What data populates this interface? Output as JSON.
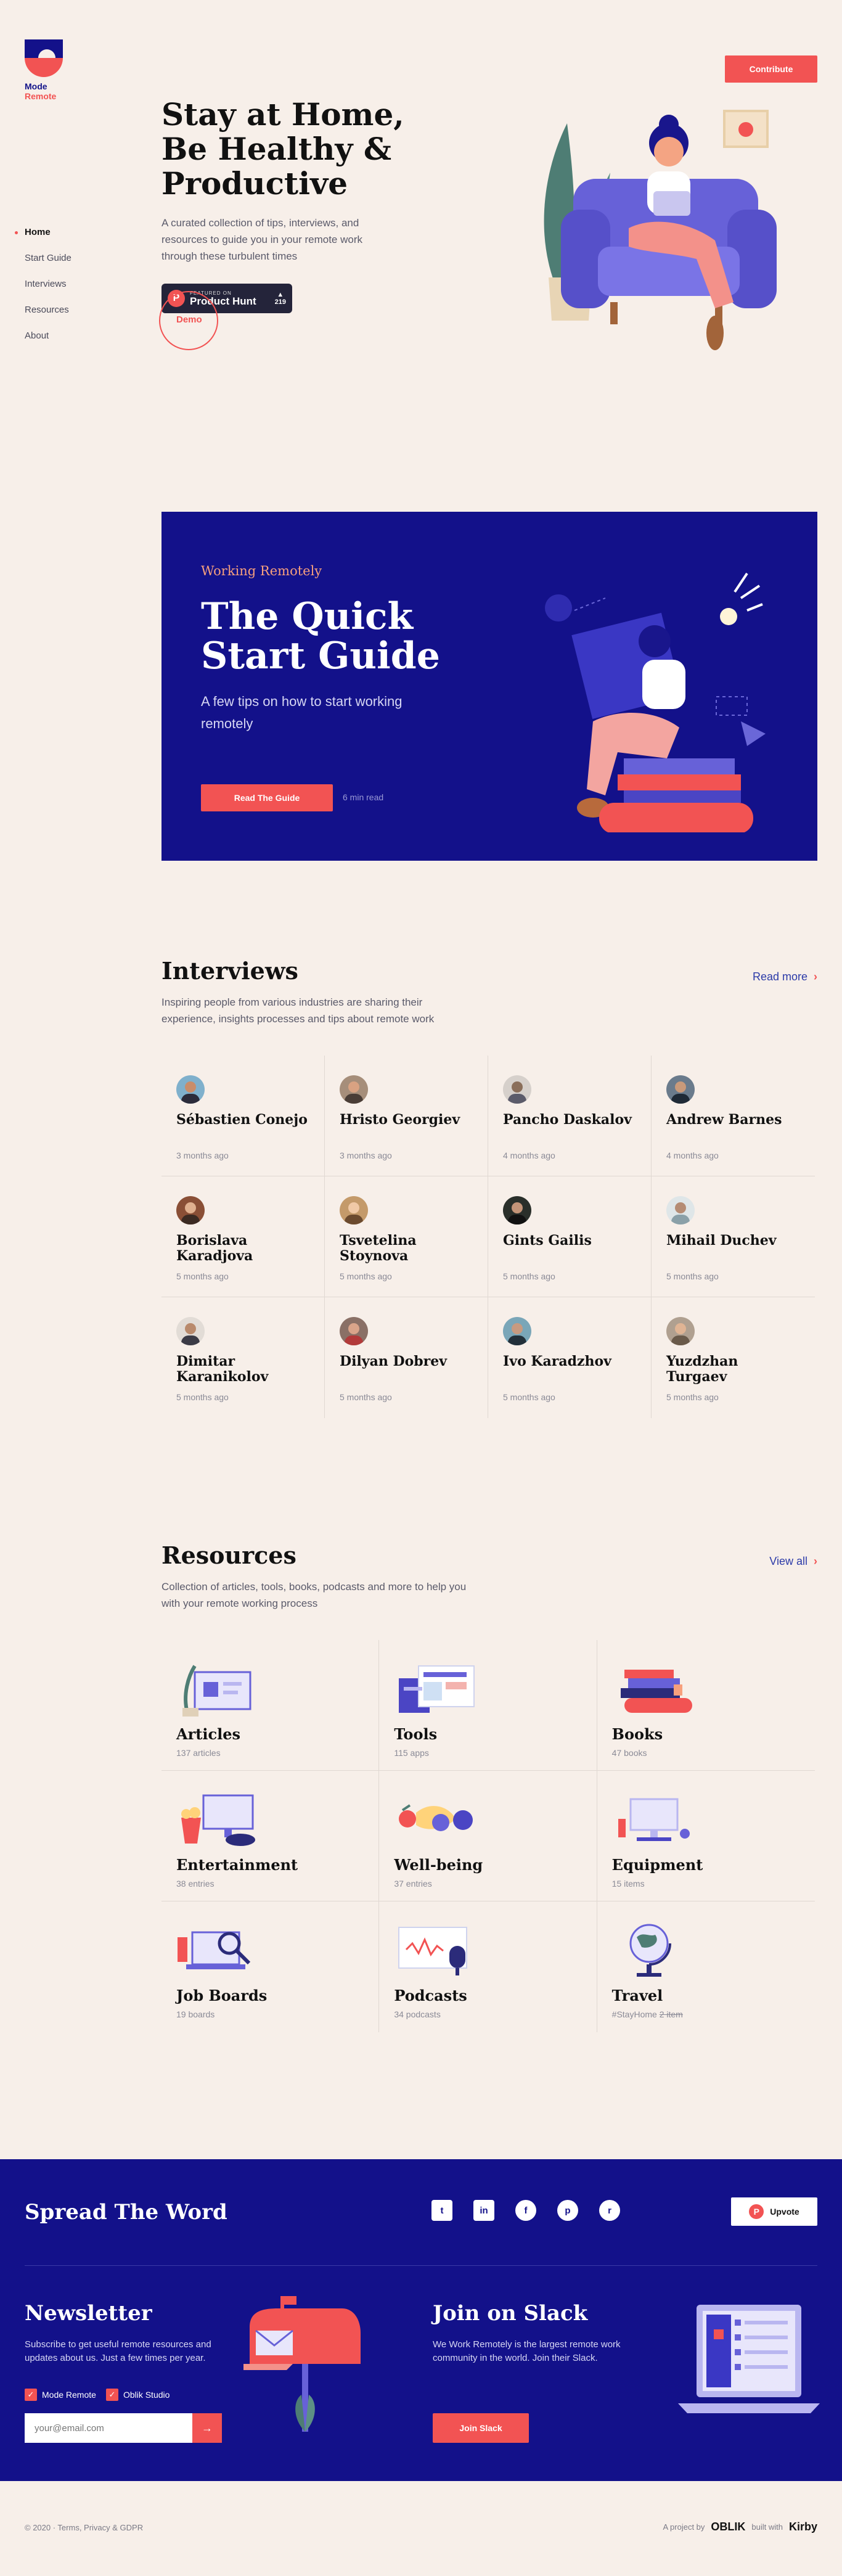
{
  "brand": {
    "line1": "Mode",
    "line2": "Remote"
  },
  "nav": [
    {
      "label": "Home",
      "active": true
    },
    {
      "label": "Start Guide",
      "active": false
    },
    {
      "label": "Interviews",
      "active": false
    },
    {
      "label": "Resources",
      "active": false
    },
    {
      "label": "About",
      "active": false
    }
  ],
  "contribute_label": "Contribute",
  "hero": {
    "title": "Stay at Home, Be Healthy & Productive",
    "subtitle": "A curated collection of tips, interviews, and resources to guide you in your remote work through these turbulent times",
    "ph_small": "FEATURED ON",
    "ph_big": "Product Hunt",
    "ph_count": "219",
    "demo_label": "Demo"
  },
  "guide": {
    "eyebrow": "Working Remotely",
    "title": "The Quick Start Guide",
    "subtitle": "A few tips on how to start working remotely",
    "button": "Read The Guide",
    "read_time": "6 min read"
  },
  "interviews": {
    "title": "Interviews",
    "subtitle": "Inspiring people from various industries are sharing their experience, insights processes and tips about remote work",
    "link": "Read more",
    "items": [
      {
        "name": "Sébastien Conejo",
        "time": "3 months ago"
      },
      {
        "name": "Hristo Georgiev",
        "time": "3 months ago"
      },
      {
        "name": "Pancho Daskalov",
        "time": "4 months ago"
      },
      {
        "name": "Andrew Barnes",
        "time": "4 months ago"
      },
      {
        "name": "Borislava Karadjova",
        "time": "5 months ago"
      },
      {
        "name": "Tsvetelina Stoynova",
        "time": "5 months ago"
      },
      {
        "name": "Gints Gailis",
        "time": "5 months ago"
      },
      {
        "name": "Mihail Duchev",
        "time": "5 months ago"
      },
      {
        "name": "Dimitar Karanikolov",
        "time": "5 months ago"
      },
      {
        "name": "Dilyan Dobrev",
        "time": "5 months ago"
      },
      {
        "name": "Ivo Karadzhov",
        "time": "5 months ago"
      },
      {
        "name": "Yuzdzhan Turgaev",
        "time": "5 months ago"
      }
    ]
  },
  "resources": {
    "title": "Resources",
    "subtitle": "Collection of articles, tools, books, podcasts and more to help you with your remote working process",
    "link": "View all",
    "items": [
      {
        "name": "Articles",
        "count": "137 articles",
        "icon": "articles-icon"
      },
      {
        "name": "Tools",
        "count": "115 apps",
        "icon": "tools-icon"
      },
      {
        "name": "Books",
        "count": "47 books",
        "icon": "books-icon"
      },
      {
        "name": "Entertainment",
        "count": "38 entries",
        "icon": "entertainment-icon"
      },
      {
        "name": "Well-being",
        "count": "37 entries",
        "icon": "wellbeing-icon"
      },
      {
        "name": "Equipment",
        "count": "15 items",
        "icon": "equipment-icon"
      },
      {
        "name": "Job Boards",
        "count": "19 boards",
        "icon": "job-boards-icon"
      },
      {
        "name": "Podcasts",
        "count": "34 podcasts",
        "icon": "podcasts-icon"
      },
      {
        "name": "Travel",
        "count": "#StayHome",
        "count_struck": "2 item",
        "icon": "travel-icon"
      }
    ]
  },
  "spread": {
    "title": "Spread The Word",
    "upvote": "Upvote"
  },
  "newsletter": {
    "title": "Newsletter",
    "subtitle": "Subscribe to get useful remote resources and updates about us. Just a few times per year.",
    "check1": "Mode Remote",
    "check2": "Oblik Studio",
    "placeholder": "your@email.com"
  },
  "slack": {
    "title": "Join on Slack",
    "subtitle": "We Work Remotely is the largest remote work community in the world. Join their Slack.",
    "button": "Join Slack"
  },
  "footer": {
    "copyright": "© 2020 · Terms, Privacy & GDPR",
    "project_by": "A project by",
    "studio": "OBLIK",
    "built_with": "built with",
    "cms": "Kirby"
  },
  "colors": {
    "accent": "#f25353",
    "navy": "#13118a",
    "background": "#f7efe9"
  }
}
